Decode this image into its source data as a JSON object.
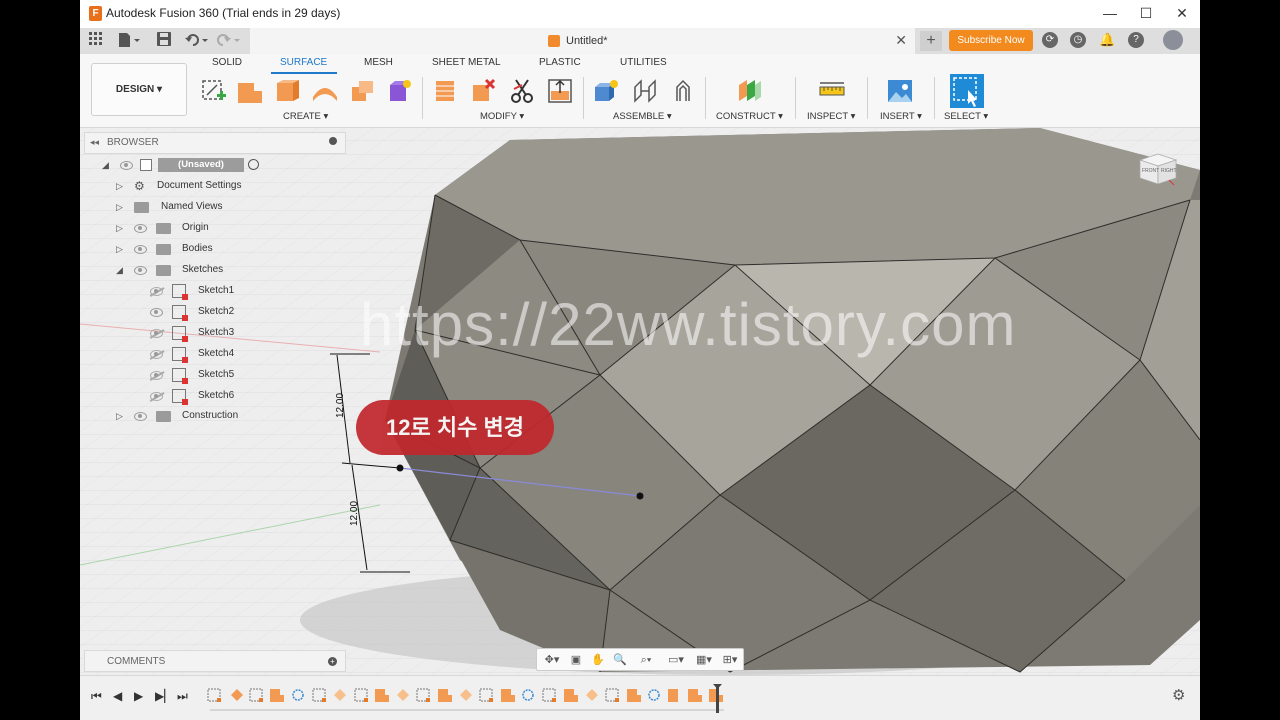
{
  "window": {
    "title": "Autodesk Fusion 360 (Trial ends in 29 days)",
    "app_icon_letter": "F",
    "minimize": "—",
    "maximize": "☐",
    "close": "✕"
  },
  "appbar": {
    "doc_title": "Untitled*",
    "doc_close": "✕",
    "new_tab": "+",
    "subscribe_label": "Subscribe Now"
  },
  "ribbon": {
    "workspace": "DESIGN ▾",
    "tabs": [
      "SOLID",
      "SURFACE",
      "MESH",
      "SHEET METAL",
      "PLASTIC",
      "UTILITIES"
    ],
    "active_tab": "SURFACE",
    "groups": [
      "CREATE ▾",
      "MODIFY ▾",
      "ASSEMBLE ▾",
      "CONSTRUCT ▾",
      "INSPECT ▾",
      "INSERT ▾",
      "SELECT ▾"
    ]
  },
  "browser": {
    "header": "BROWSER",
    "root": "(Unsaved)",
    "items": [
      {
        "label": "Document Settings",
        "icon": "gear-icon"
      },
      {
        "label": "Named Views",
        "icon": "folder-icon"
      },
      {
        "label": "Origin",
        "icon": "folder-icon"
      },
      {
        "label": "Bodies",
        "icon": "folder-icon"
      },
      {
        "label": "Sketches",
        "icon": "folder-icon"
      },
      {
        "label": "Sketch1",
        "icon": "sketch-icon"
      },
      {
        "label": "Sketch2",
        "icon": "sketch-icon"
      },
      {
        "label": "Sketch3",
        "icon": "sketch-icon"
      },
      {
        "label": "Sketch4",
        "icon": "sketch-icon"
      },
      {
        "label": "Sketch5",
        "icon": "sketch-icon"
      },
      {
        "label": "Sketch6",
        "icon": "sketch-icon"
      },
      {
        "label": "Construction",
        "icon": "folder-icon"
      }
    ]
  },
  "comments": {
    "header": "COMMENTS"
  },
  "viewport": {
    "dimension_1": "12.00",
    "dimension_2": "12.00",
    "viewcube_front": "FRONT",
    "viewcube_right": "RIGHT",
    "watermark": "https://22ww.tistory.com",
    "callout": "12로 치수 변경"
  },
  "colors": {
    "accent": "#1f78c8",
    "subscribe": "#f28a1e",
    "callout": "#c1282d",
    "model_fill": "#7c7a72"
  }
}
